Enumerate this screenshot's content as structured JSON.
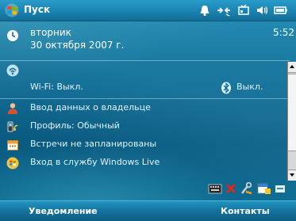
{
  "title_bar": {
    "start_label": "Пуск",
    "icons": [
      "flag-windows-icon",
      "alarm-bell-icon",
      "connectivity-icon",
      "signal-icon",
      "volume-icon",
      "battery-icon"
    ]
  },
  "date_panel": {
    "weekday": "вторник",
    "date": "30 октября 2007 г.",
    "time": "5:52"
  },
  "today_items": {
    "wireless": {
      "wifi_label": "Wi-Fi: Выкл.",
      "bluetooth_label": "Выкл."
    },
    "owner": {
      "label": "Ввод данных о владельце"
    },
    "profile": {
      "label": "Профиль: Обычный"
    },
    "appointments": {
      "label": "Встречи не запланированы"
    },
    "windows_live": {
      "label": "Вход в службу Windows Live"
    }
  },
  "tray_icons": [
    "keyboard-icon",
    "pen-x-icon",
    "tools-icon",
    "calendar-tray-icon",
    "sync-icon"
  ],
  "softkeys": {
    "left": "Уведомление",
    "right": "Контакты"
  },
  "colors": {
    "background": "#0e6b93",
    "title_bar": "#1a83b0",
    "text": "#ffffff",
    "item_text": "#dff4ff"
  }
}
